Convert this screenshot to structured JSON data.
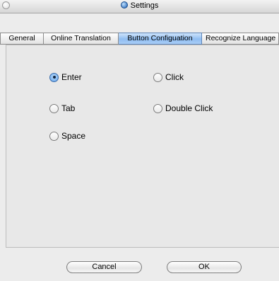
{
  "window": {
    "title": "Settings",
    "title_icon": "app-globe-icon"
  },
  "tabs": [
    {
      "label": "General",
      "active": false
    },
    {
      "label": "Online Translation",
      "active": false
    },
    {
      "label": "Button Configuation",
      "active": true
    },
    {
      "label": "Recognize Language",
      "active": false
    }
  ],
  "options": {
    "enter": {
      "label": "Enter",
      "checked": true
    },
    "click": {
      "label": "Click",
      "checked": false
    },
    "tab": {
      "label": "Tab",
      "checked": false
    },
    "double_click": {
      "label": "Double Click",
      "checked": false
    },
    "space": {
      "label": "Space",
      "checked": false
    }
  },
  "buttons": {
    "cancel": "Cancel",
    "ok": "OK"
  },
  "colors": {
    "active_tab": "#8fbdf1",
    "window_bg": "#ececec"
  }
}
